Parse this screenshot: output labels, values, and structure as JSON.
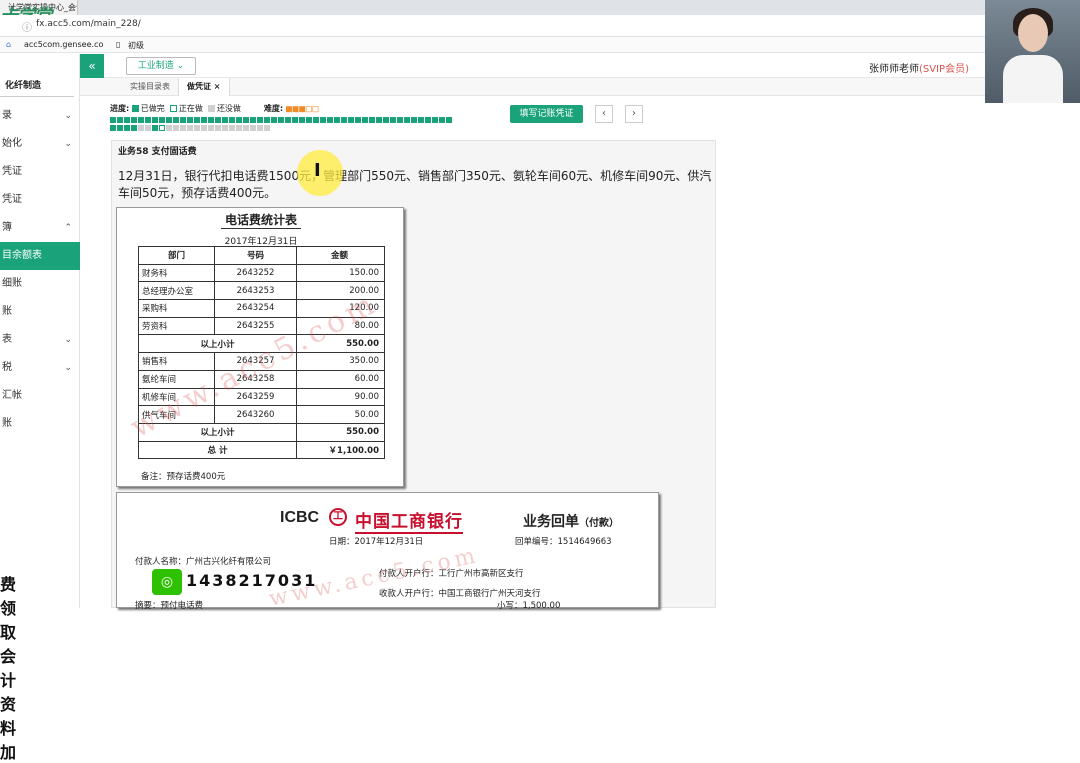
{
  "browser": {
    "tab_title": "计学堂实操中心_会计",
    "logo_text": "卡学堂",
    "url": "fx.acc5.com/main_228/",
    "bookmarks": [
      "acc5com.gensee.co",
      "初级"
    ]
  },
  "sidebar": {
    "title": "化纤制造",
    "items": [
      {
        "label": "录",
        "chevron": "⌄"
      },
      {
        "label": "始化",
        "chevron": "⌄"
      },
      {
        "label": "凭证",
        "chevron": ""
      },
      {
        "label": "凭证",
        "chevron": ""
      },
      {
        "label": "簿",
        "chevron": "⌃"
      },
      {
        "label": "目余额表",
        "chevron": "",
        "active": true
      },
      {
        "label": "细账",
        "chevron": ""
      },
      {
        "label": "账",
        "chevron": ""
      },
      {
        "label": "表",
        "chevron": "⌄"
      },
      {
        "label": "税",
        "chevron": "⌄"
      },
      {
        "label": "汇帐",
        "chevron": ""
      },
      {
        "label": "账",
        "chevron": ""
      }
    ]
  },
  "header": {
    "collapse_icon": "«",
    "industry": "工业制造 ⌄",
    "teacher": "张师师老师",
    "svip": "(SVIP会员)"
  },
  "subtabs": [
    {
      "label": "实操目录表"
    },
    {
      "label": "做凭证 ×",
      "active": true
    }
  ],
  "progress": {
    "label": "进度:",
    "done": "已做完",
    "doing": "正在做",
    "todo": "还没做",
    "difficulty_label": "难度:",
    "difficulty": 3,
    "colors": {
      "done": "#1aa37a",
      "doing": "#ffffff",
      "todo": "#d0d0d0"
    }
  },
  "actions": {
    "fill_button": "填写记账凭证",
    "prev": "‹",
    "next": "›"
  },
  "business": {
    "title": "业务58 支付固话费",
    "description": "12月31日，银行代扣电话费1500元，管理部门550元、销售部门350元、氨轮车间60元、机修车间90元、供汽车间50元，预存话费400元。"
  },
  "phone_table": {
    "title": "电话费统计表",
    "date": "2017年12月31日",
    "headers": [
      "部门",
      "号码",
      "金额"
    ],
    "rows": [
      {
        "dept": "财务科",
        "num": "2643252",
        "amt": "150.00"
      },
      {
        "dept": "总经理办公室",
        "num": "2643253",
        "amt": "200.00"
      },
      {
        "dept": "采购科",
        "num": "2643254",
        "amt": "120.00"
      },
      {
        "dept": "劳资科",
        "num": "2643255",
        "amt": "80.00"
      },
      {
        "subtotal": true,
        "label": "以上小计",
        "amt": "550.00"
      },
      {
        "dept": "销售科",
        "num": "2643257",
        "amt": "350.00"
      },
      {
        "dept": "氨纶车间",
        "num": "2643258",
        "amt": "60.00"
      },
      {
        "dept": "机修车间",
        "num": "2643259",
        "amt": "90.00"
      },
      {
        "dept": "供气车间",
        "num": "2643260",
        "amt": "50.00"
      },
      {
        "subtotal": true,
        "label": "以上小计",
        "amt": "550.00"
      },
      {
        "subtotal": true,
        "label": "总   计",
        "amt": "￥1,100.00"
      }
    ],
    "note": "备注：预存话费400元",
    "watermark": "www.acc5.com"
  },
  "bank_receipt": {
    "brand": "ICBC",
    "logo_glyph": "工",
    "bank_name": "中国工商银行",
    "title": "业务回单",
    "title_suffix": "（付款）",
    "date": "日期：2017年12月31日",
    "receipt_no": "回单编号：1514649663",
    "payer_name": "付款人名称：广州古兴化纤有限公司",
    "payer_bank": "付款人开户行：工行广州市高新区支行",
    "payee_bank": "收款人开户行：中国工商银行广州天河支行",
    "amount_small": "小写：1,500.00",
    "memo": "摘要：预付电话费",
    "watermark": "www.acc5.com"
  },
  "promo": {
    "text": "费领取会计资料加",
    "number": "1438217031"
  }
}
